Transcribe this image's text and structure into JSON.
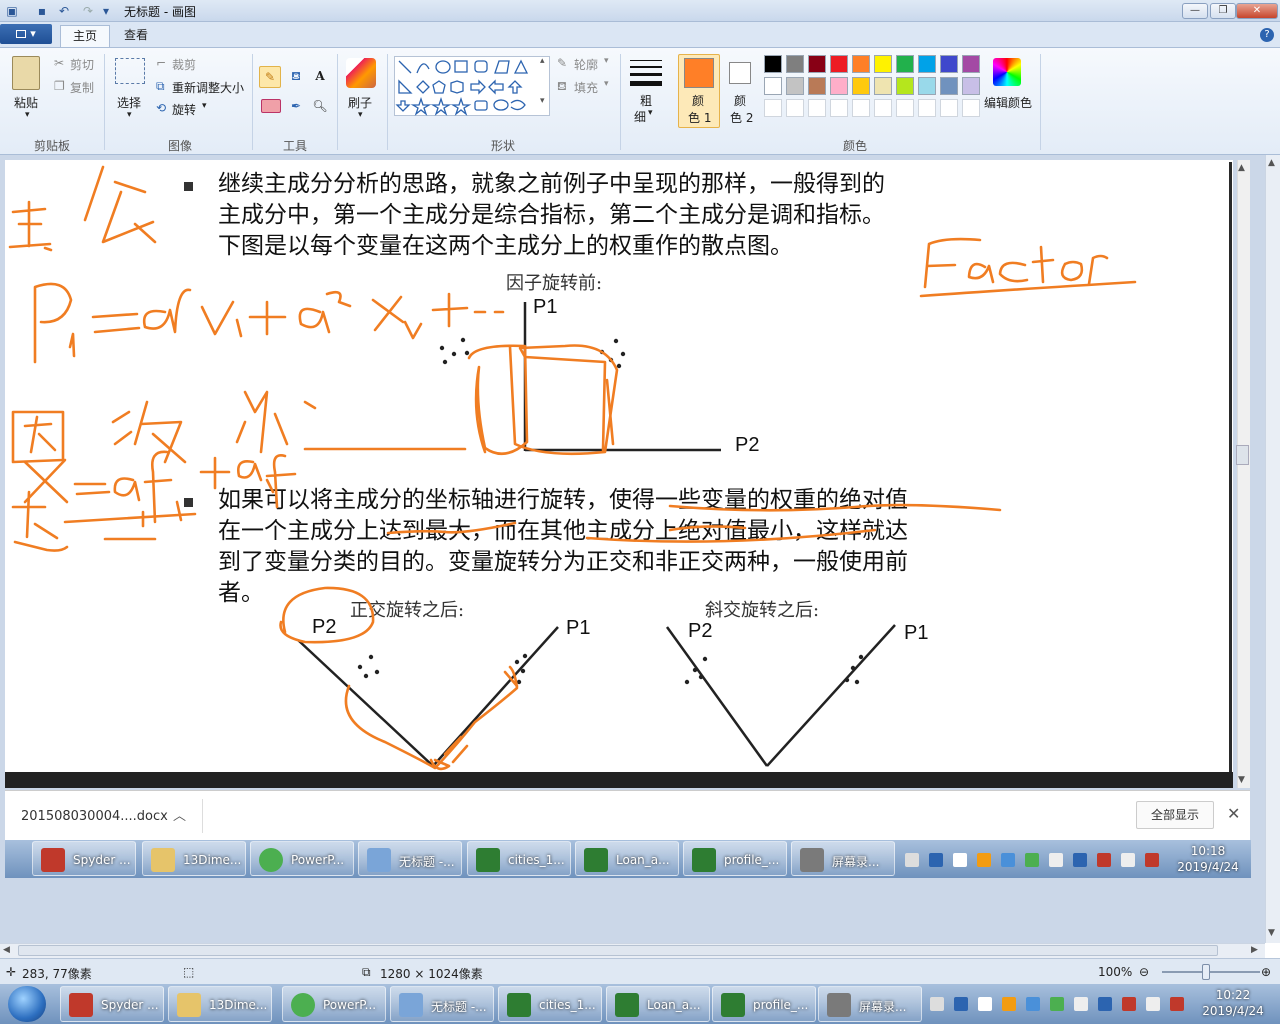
{
  "window": {
    "title": "无标题 - 画图"
  },
  "tabs": {
    "file_label": "▾",
    "home": "主页",
    "view": "查看"
  },
  "ribbon": {
    "clipboard": {
      "paste": "粘贴",
      "cut": "剪切",
      "copy": "复制",
      "group": "剪贴板"
    },
    "image": {
      "select": "选择",
      "crop": "裁剪",
      "resize": "重新调整大小",
      "rotate": "旋转",
      "group": "图像"
    },
    "tools": {
      "group": "工具"
    },
    "brushes": {
      "label": "刷子"
    },
    "shapes": {
      "outline": "轮廓",
      "fill": "填充",
      "group": "形状"
    },
    "size": {
      "label_1": "粗",
      "label_2": "细"
    },
    "colors": {
      "color1_label_1": "颜",
      "color1_label_2": "色 1",
      "color2_label_1": "颜",
      "color2_label_2": "色 2",
      "edit": "编辑颜色",
      "group": "颜色",
      "color1": "#ff7f27",
      "color2": "#ffffff",
      "palette_row1": [
        "#000000",
        "#7f7f7f",
        "#880015",
        "#ed1c24",
        "#ff7f27",
        "#fff200",
        "#22b14c",
        "#00a2e8",
        "#3f48cc",
        "#a349a4"
      ],
      "palette_row2": [
        "#ffffff",
        "#c3c3c3",
        "#b97a57",
        "#ffaec9",
        "#ffc90e",
        "#efe4b0",
        "#b5e61d",
        "#99d9ea",
        "#7092be",
        "#c8bfe7"
      ]
    }
  },
  "document": {
    "para1_line1": "继续主成分分析的思路，就象之前例子中呈现的那样，一般得到的",
    "para1_line2": "主成分中，第一个主成分是综合指标，第二个主成分是调和指标。",
    "para1_line3": "下图是以每个变量在这两个主成分上的权重作的散点图。",
    "fig1_title": "因子旋转前:",
    "fig1_p1": "P1",
    "fig1_p2": "P2",
    "para2_line1": "如果可以将主成分的坐标轴进行旋转，使得一些变量的权重的绝对值",
    "para2_line2": "在一个主成分上达到最大，而在其他主成分上绝对值最小，这样就达",
    "para2_line3": "到了变量分类的目的。变量旋转分为正交和非正交两种，一般使用前",
    "para2_line4": "者。",
    "fig2_title": "正交旋转之后:",
    "fig2_p2": "P2",
    "fig2_p1": "P1",
    "fig3_title": "斜交旋转之后:",
    "fig3_p2": "P2",
    "fig3_p1": "P1"
  },
  "annotation_color": "#f07d22",
  "download_bar": {
    "file": "201508030004....docx",
    "show_all": "全部显示",
    "chevron": "︿",
    "close": "✕"
  },
  "inner_taskbar": {
    "items": [
      "Spyder ...",
      "13Dime...",
      "PowerP...",
      "无标题 -...",
      "cities_1...",
      "Loan_a...",
      "profile_...",
      "屏幕录..."
    ],
    "time": "10:18",
    "date": "2019/4/24"
  },
  "statusbar": {
    "cursor": "283, 77像素",
    "size": "1280 × 1024像素",
    "zoom": "100%"
  },
  "outer_taskbar": {
    "items": [
      "Spyder ...",
      "13Dime...",
      "PowerP...",
      "无标题 -...",
      "cities_1...",
      "Loan_a...",
      "profile_...",
      "屏幕录..."
    ],
    "time": "10:22",
    "date": "2019/4/24"
  }
}
